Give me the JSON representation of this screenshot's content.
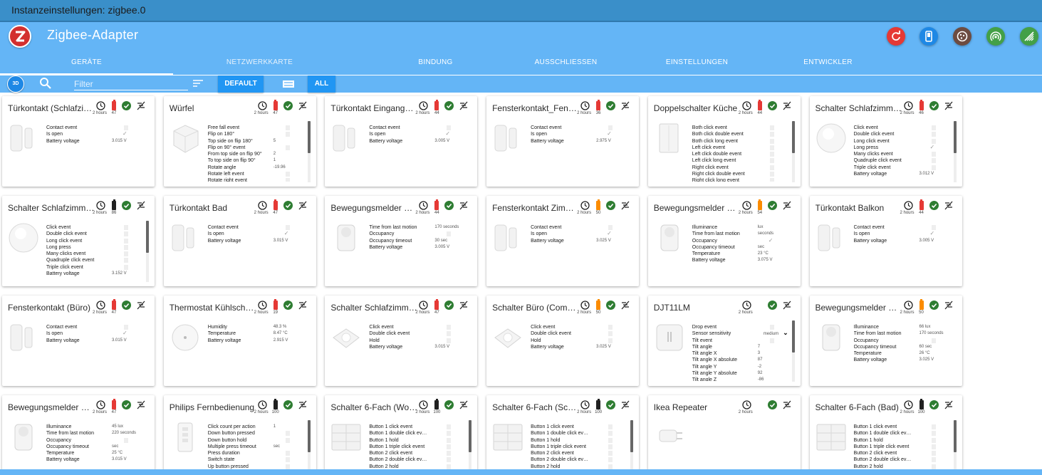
{
  "window": {
    "title": "Instanzeinstellungen: zigbee.0"
  },
  "app": {
    "title": "Zigbee-Adapter"
  },
  "colors": {
    "titlebar": "#3a8fc9",
    "appbar": "#64b5f6",
    "accent": "#2196f3",
    "battery_red": "#e53935",
    "battery_orange": "#fb8c00",
    "battery_black": "#212121",
    "ok_green": "#2e7d32"
  },
  "toolbar_buttons": [
    {
      "icon": "refresh-icon",
      "color": "#e53935"
    },
    {
      "icon": "smartphone-icon",
      "color": "#1e88e5"
    },
    {
      "icon": "cookie-icon",
      "color": "#6d4c41"
    },
    {
      "icon": "wifi-tethering-icon",
      "color": "#43a047"
    },
    {
      "icon": "network-check-icon",
      "color": "#43a047"
    }
  ],
  "tabs": [
    "GERÄTE",
    "NETZWERKKARTE",
    "BINDUNG",
    "AUSSCHLIESSEN",
    "EINSTELLUNGEN",
    "ENTWICKLER"
  ],
  "filter": {
    "placeholder": "Filter",
    "value": ""
  },
  "chips": {
    "btn3d": "3D",
    "default": "DEFAULT",
    "all": "ALL"
  },
  "cards": [
    {
      "title": "Türkontakt (Schlafzi…",
      "since": "2 hours",
      "battery": "47",
      "battery_level": "red",
      "image": "contact",
      "states": [
        {
          "n": "Contact event",
          "ctl": "box"
        },
        {
          "n": "Is open",
          "ctl": "check"
        },
        {
          "n": "Battery voltage",
          "v": "3.015 V"
        }
      ]
    },
    {
      "title": "Würfel",
      "since": "2 hours",
      "battery": "47",
      "battery_level": "red",
      "image": "cube",
      "scroll": true,
      "states": [
        {
          "n": "Free fall event",
          "ctl": "box"
        },
        {
          "n": "Flip on 180°",
          "ctl": "box"
        },
        {
          "n": "Top side on flip 180°",
          "v": "5"
        },
        {
          "n": "Flip on 90° event",
          "ctl": "box"
        },
        {
          "n": "From top side on flip 90°",
          "v": "2"
        },
        {
          "n": "To top side on flip 90°",
          "v": "1"
        },
        {
          "n": "Rotate angle",
          "v": "-19.96"
        },
        {
          "n": "Rotate left event",
          "ctl": "box"
        },
        {
          "n": "Rotate right event",
          "ctl": "box"
        }
      ]
    },
    {
      "title": "Türkontakt Eingang…",
      "since": "2 hours",
      "battery": "44",
      "battery_level": "red",
      "image": "contact",
      "states": [
        {
          "n": "Contact event",
          "ctl": "box"
        },
        {
          "n": "Is open",
          "ctl": "check"
        },
        {
          "n": "Battery voltage",
          "v": "3.005 V"
        }
      ]
    },
    {
      "title": "Fensterkontakt_Fens…",
      "since": "2 hours",
      "battery": "36",
      "battery_level": "red",
      "image": "contact",
      "states": [
        {
          "n": "Contact event",
          "ctl": "box"
        },
        {
          "n": "Is open",
          "ctl": "check"
        },
        {
          "n": "Battery voltage",
          "v": "2.975 V"
        }
      ]
    },
    {
      "title": "Doppelschalter Küche",
      "since": "2 hours",
      "battery": "44",
      "battery_level": "red",
      "image": "wallswitch",
      "scroll": true,
      "states": [
        {
          "n": "Both click event",
          "ctl": "box"
        },
        {
          "n": "Both click double event",
          "ctl": "box"
        },
        {
          "n": "Both click long event",
          "ctl": "box"
        },
        {
          "n": "Left click event",
          "ctl": "box"
        },
        {
          "n": "Left click double event",
          "ctl": "box"
        },
        {
          "n": "Left click long event",
          "ctl": "box"
        },
        {
          "n": "Right click event",
          "ctl": "box"
        },
        {
          "n": "Right click double event",
          "ctl": "box"
        },
        {
          "n": "Right click long event",
          "ctl": "box"
        }
      ]
    },
    {
      "title": "Schalter Schlafzimm…",
      "since": "2 hours",
      "battery": "46",
      "battery_level": "red",
      "image": "roundswitch",
      "scroll": true,
      "states": [
        {
          "n": "Click event",
          "ctl": "box"
        },
        {
          "n": "Double click event",
          "ctl": "box"
        },
        {
          "n": "Long click event",
          "ctl": "box"
        },
        {
          "n": "Long press",
          "ctl": "check"
        },
        {
          "n": "Many clicks event",
          "ctl": "box"
        },
        {
          "n": "Quadruple click event",
          "ctl": "box"
        },
        {
          "n": "Triple click event",
          "ctl": "box"
        },
        {
          "n": "Battery voltage",
          "v": "3.012 V"
        }
      ]
    },
    {
      "title": "Schalter Schlafzimm…",
      "since": "2 hours",
      "battery": "86",
      "battery_level": "black",
      "image": "roundswitch",
      "scroll": true,
      "states": [
        {
          "n": "Click event",
          "ctl": "box"
        },
        {
          "n": "Double click event",
          "ctl": "box"
        },
        {
          "n": "Long click event",
          "ctl": "box"
        },
        {
          "n": "Long press",
          "ctl": "box"
        },
        {
          "n": "Many clicks event",
          "ctl": "box"
        },
        {
          "n": "Quadruple click event",
          "ctl": "box"
        },
        {
          "n": "Triple click event",
          "ctl": "box"
        },
        {
          "n": "Battery voltage",
          "v": "3.152 V"
        }
      ]
    },
    {
      "title": "Türkontakt Bad",
      "since": "2 hours",
      "battery": "47",
      "battery_level": "red",
      "image": "contact",
      "states": [
        {
          "n": "Contact event",
          "ctl": "box"
        },
        {
          "n": "Is open",
          "ctl": "check"
        },
        {
          "n": "Battery voltage",
          "v": "3.015 V"
        }
      ]
    },
    {
      "title": "Bewegungsmelder B…",
      "since": "2 hours",
      "battery": "44",
      "battery_level": "red",
      "image": "motion",
      "states": [
        {
          "n": "Time from last motion",
          "v": "170 seconds"
        },
        {
          "n": "Occupancy",
          "ctl": "box"
        },
        {
          "n": "Occupancy timeout",
          "v": "30 sec"
        },
        {
          "n": "Battery voltage",
          "v": "3.005 V"
        }
      ]
    },
    {
      "title": "Fensterkontakt Zim…",
      "since": "2 hours",
      "battery": "50",
      "battery_level": "orange",
      "image": "contact",
      "states": [
        {
          "n": "Contact event",
          "ctl": "box"
        },
        {
          "n": "Is open",
          "ctl": "check"
        },
        {
          "n": "Battery voltage",
          "v": "3.025 V"
        }
      ]
    },
    {
      "title": "Bewegungsmelder Fl…",
      "since": "2 hours",
      "battery": "54",
      "battery_level": "orange",
      "image": "motion",
      "states": [
        {
          "n": "Illuminance",
          "v": "lux"
        },
        {
          "n": "Time from last motion",
          "v": "seconds"
        },
        {
          "n": "Occupancy",
          "ctl": "check"
        },
        {
          "n": "Occupancy timeout",
          "v": "sec"
        },
        {
          "n": "Temperature",
          "v": "23 °C"
        },
        {
          "n": "Battery voltage",
          "v": "3.075 V"
        }
      ]
    },
    {
      "title": "Türkontakt Balkon",
      "since": "2 hours",
      "battery": "44",
      "battery_level": "red",
      "image": "contact",
      "states": [
        {
          "n": "Contact event",
          "ctl": "box"
        },
        {
          "n": "Is open",
          "ctl": "check"
        },
        {
          "n": "Battery voltage",
          "v": "3.005 V"
        }
      ]
    },
    {
      "title": "Fensterkontakt (Büro)",
      "since": "2 hours",
      "battery": "47",
      "battery_level": "red",
      "image": "contact",
      "states": [
        {
          "n": "Contact event",
          "ctl": "box"
        },
        {
          "n": "Is open",
          "ctl": "check"
        },
        {
          "n": "Battery voltage",
          "v": "3.015 V"
        }
      ]
    },
    {
      "title": "Thermostat Kühlsch…",
      "since": "2 hours",
      "battery": "19",
      "battery_level": "red",
      "image": "thermo",
      "states": [
        {
          "n": "Humidity",
          "v": "48.3 %"
        },
        {
          "n": "Temperature",
          "v": "8.47 °C"
        },
        {
          "n": "Battery voltage",
          "v": "2.915 V"
        }
      ]
    },
    {
      "title": "Schalter Schlafzimm…",
      "since": "2 hours",
      "battery": "47",
      "battery_level": "red",
      "image": "button",
      "states": [
        {
          "n": "Click event",
          "ctl": "box"
        },
        {
          "n": "Double click event",
          "ctl": "box"
        },
        {
          "n": "Hold",
          "ctl": "box"
        },
        {
          "n": "Battery voltage",
          "v": "3.015 V"
        }
      ]
    },
    {
      "title": "Schalter Büro (Comp…",
      "since": "2 hours",
      "battery": "50",
      "battery_level": "orange",
      "image": "button",
      "states": [
        {
          "n": "Click event",
          "ctl": "box"
        },
        {
          "n": "Double click event",
          "ctl": "box"
        },
        {
          "n": "Hold",
          "ctl": "box"
        },
        {
          "n": "Battery voltage",
          "v": "3.025 V"
        }
      ]
    },
    {
      "title": "DJT11LM",
      "since": "2 hours",
      "battery": "",
      "battery_level": "none",
      "image": "vibration",
      "scroll": true,
      "states": [
        {
          "n": "Drop event",
          "ctl": "box"
        },
        {
          "n": "Sensor sensitivity",
          "sel": "medium"
        },
        {
          "n": "Tilt event",
          "ctl": "box"
        },
        {
          "n": "Tilt angle",
          "v": "7"
        },
        {
          "n": "Tilt angle X",
          "v": "3"
        },
        {
          "n": "Tilt angle X absolute",
          "v": "87"
        },
        {
          "n": "Tilt angle Y",
          "v": "-2"
        },
        {
          "n": "Tilt angle Y absolute",
          "v": "92"
        },
        {
          "n": "Tilt angle Z",
          "v": "-86"
        }
      ]
    },
    {
      "title": "Bewegungsmelder B…",
      "since": "2 hours",
      "battery": "50",
      "battery_level": "orange",
      "image": "motion",
      "states": [
        {
          "n": "Illuminance",
          "v": "66 lux"
        },
        {
          "n": "Time from last motion",
          "v": "170 seconds"
        },
        {
          "n": "Occupancy",
          "ctl": "box"
        },
        {
          "n": "Occupancy timeout",
          "v": "60 sec"
        },
        {
          "n": "Temperature",
          "v": "26 °C"
        },
        {
          "n": "Battery voltage",
          "v": "3.025 V"
        }
      ]
    },
    {
      "title": "Bewegungsmelder K…",
      "since": "2 hours",
      "battery": "47",
      "battery_level": "red",
      "image": "motion",
      "states": [
        {
          "n": "Illuminance",
          "v": "45 lux"
        },
        {
          "n": "Time from last motion",
          "v": "220 seconds"
        },
        {
          "n": "Occupancy",
          "ctl": "box"
        },
        {
          "n": "Occupancy timeout",
          "v": "sec"
        },
        {
          "n": "Temperature",
          "v": "25 °C"
        },
        {
          "n": "Battery voltage",
          "v": "3.015 V"
        }
      ]
    },
    {
      "title": "Philips Fernbedienung",
      "since": "2 hours",
      "battery": "100",
      "battery_level": "black",
      "image": "remote",
      "scroll": true,
      "states": [
        {
          "n": "Click count per action",
          "v": "1"
        },
        {
          "n": "Down button pressed",
          "ctl": "box"
        },
        {
          "n": "Down button hold",
          "ctl": "box"
        },
        {
          "n": "Multiple press timeout",
          "v": "sec"
        },
        {
          "n": "Press duration",
          "ctl": "box"
        },
        {
          "n": "Switch state",
          "ctl": "box"
        },
        {
          "n": "Up button pressed",
          "ctl": "box"
        }
      ]
    },
    {
      "title": "Schalter 6-Fach (Wo…",
      "since": "2 hours",
      "battery": "100",
      "battery_level": "black",
      "image": "six",
      "scroll": true,
      "states": [
        {
          "n": "Button 1 click event",
          "ctl": "box"
        },
        {
          "n": "Button 1 double click ev…",
          "ctl": "box"
        },
        {
          "n": "Button 1 hold",
          "ctl": "box"
        },
        {
          "n": "Button 1 triple click event",
          "ctl": "box"
        },
        {
          "n": "Button 2 click event",
          "ctl": "box"
        },
        {
          "n": "Button 2 double click ev…",
          "ctl": "box"
        },
        {
          "n": "Button 2 hold",
          "ctl": "box"
        }
      ]
    },
    {
      "title": "Schalter 6-Fach (Schl…",
      "since": "2 hours",
      "battery": "100",
      "battery_level": "black",
      "image": "six",
      "scroll": true,
      "states": [
        {
          "n": "Button 1 click event",
          "ctl": "box"
        },
        {
          "n": "Button 1 double click ev…",
          "ctl": "box"
        },
        {
          "n": "Button 1 hold",
          "ctl": "box"
        },
        {
          "n": "Button 1 triple click event",
          "ctl": "box"
        },
        {
          "n": "Button 2 click event",
          "ctl": "box"
        },
        {
          "n": "Button 2 double click ev…",
          "ctl": "box"
        },
        {
          "n": "Button 2 hold",
          "ctl": "box"
        }
      ]
    },
    {
      "title": "Ikea Repeater",
      "since": "2 hours",
      "battery": "",
      "battery_level": "none",
      "image": "repeater",
      "states": []
    },
    {
      "title": "Schalter 6-Fach (Bad)",
      "since": "2 hours",
      "battery": "100",
      "battery_level": "black",
      "image": "six",
      "scroll": true,
      "states": [
        {
          "n": "Button 1 click event",
          "ctl": "box"
        },
        {
          "n": "Button 1 double click ev…",
          "ctl": "box"
        },
        {
          "n": "Button 1 hold",
          "ctl": "box"
        },
        {
          "n": "Button 1 triple click event",
          "ctl": "box"
        },
        {
          "n": "Button 2 click event",
          "ctl": "box"
        },
        {
          "n": "Button 2 double click ev…",
          "ctl": "box"
        },
        {
          "n": "Button 2 hold",
          "ctl": "box"
        }
      ]
    }
  ]
}
